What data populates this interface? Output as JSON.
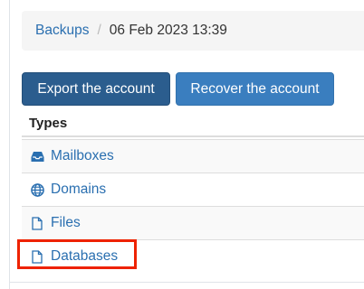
{
  "breadcrumb": {
    "parent": "Backups",
    "separator": "/",
    "current": "06 Feb 2023 13:39"
  },
  "actions": {
    "export_label": "Export the account",
    "recover_label": "Recover the account"
  },
  "types_table": {
    "header": "Types",
    "rows": [
      {
        "label": "Mailboxes",
        "icon": "inbox-icon"
      },
      {
        "label": "Domains",
        "icon": "globe-icon"
      },
      {
        "label": "Files",
        "icon": "file-icon"
      },
      {
        "label": "Databases",
        "icon": "file-icon"
      }
    ]
  },
  "colors": {
    "link": "#2a6fb0",
    "export_button": "#2b5d8e",
    "recover_button": "#3a7ebf",
    "highlight": "#ee2200"
  }
}
